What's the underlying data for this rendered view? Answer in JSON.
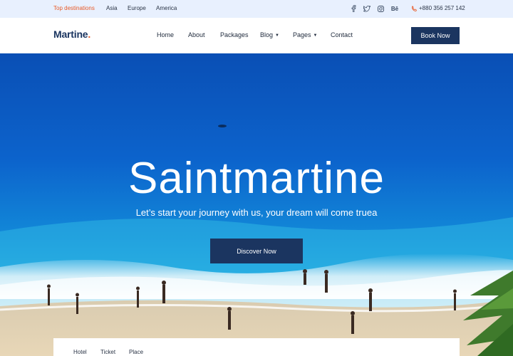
{
  "topbar": {
    "destinations_label": "Top destinations",
    "destinations": [
      "Asia",
      "Europe",
      "America"
    ],
    "social_icons": [
      "facebook-icon",
      "twitter-icon",
      "instagram-icon",
      "behance-icon"
    ],
    "behance_label": "Bē",
    "phone": "+880 356 257 142"
  },
  "header": {
    "logo": "Martine",
    "logo_dot": ".",
    "nav": {
      "home": "Home",
      "about": "About",
      "packages": "Packages",
      "blog": "Blog",
      "pages": "Pages",
      "contact": "Contact"
    },
    "book_now": "Book Now"
  },
  "hero": {
    "title": "Saintmartine",
    "subtitle": "Let’s start your journey with us, your dream will come truea",
    "cta": "Discover Now"
  },
  "search": {
    "tabs": {
      "hotel": "Hotel",
      "ticket": "Ticket",
      "place": "Place"
    }
  },
  "colors": {
    "brand": "#1b3560",
    "accent": "#e85a28",
    "topbar_bg": "#e8f0fe"
  }
}
